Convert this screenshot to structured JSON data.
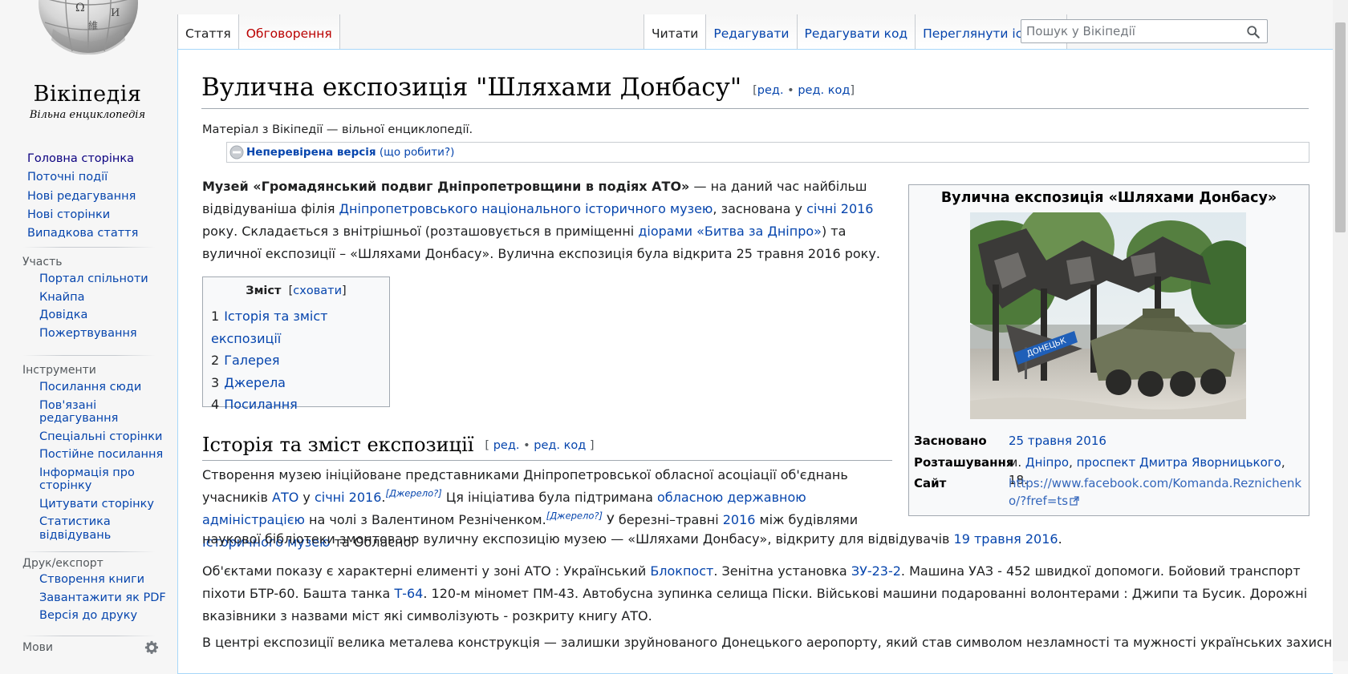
{
  "logo": {
    "wordmark": "Вікіпедія",
    "tagline": "Вільна енциклопедія"
  },
  "sidebar": {
    "main": [
      "Головна сторінка",
      "Поточні події",
      "Нові редагування",
      "Нові сторінки",
      "Випадкова стаття"
    ],
    "participation": {
      "heading": "Участь",
      "items": [
        "Портал спільноти",
        "Кнайпа",
        "Довідка",
        "Пожертвування"
      ]
    },
    "tools": {
      "heading": "Інструменти",
      "items": [
        "Посилання сюди",
        "Пов'язані редагування",
        "Спеціальні сторінки",
        "Постійне посилання",
        "Інформація про сторінку",
        "Цитувати сторінку",
        "Статистика відвідувань"
      ]
    },
    "print": {
      "heading": "Друк/експорт",
      "items": [
        "Створення книги",
        "Завантажити як PDF",
        "Версія до друку"
      ]
    },
    "languages": {
      "heading": "Мови",
      "icon": "gear-icon"
    }
  },
  "tabs": {
    "namespaces": [
      "Стаття",
      "Обговорення"
    ],
    "views": [
      "Читати",
      "Редагувати",
      "Редагувати код",
      "Переглянути історію"
    ]
  },
  "search": {
    "placeholder": "Пошук у Вікіпедії",
    "icon": "search-icon"
  },
  "article": {
    "title": "Вулична експозиція \"Шляхами Донбасу\"",
    "edit_links": {
      "open": "[",
      "edit": "ред.",
      "sep": " • ",
      "edit_source": "ред. код",
      "close": "]"
    },
    "site_sub": "Матеріал з Вікіпедії — вільної енциклопедії.",
    "flagged": {
      "status": "Неперевірена версія",
      "help": "(що робити?)"
    },
    "intro": {
      "bold": "Музей «Громадянський подвиг Дніпропетровщини в подіях АТО»",
      "t1": " — на даний час найбільш відвідуваніша філія ",
      "l1": "Дніпропетровського національного історичного музею",
      "t2": ", заснована у ",
      "l2": "січні 2016",
      "t3": " року. Складається з внітрішньої (розташовується в приміщенні ",
      "l3": "діорами «Битва за Дніпро»",
      "t4": ") та вуличної експозиції – «Шляхами Донбасу». Вулична експозиція була відкрита 25 травня 2016 року."
    },
    "toc": {
      "title": "Зміст",
      "toggle": "сховати",
      "items": [
        {
          "num": "1",
          "label": "Історія та зміст експозиції"
        },
        {
          "num": "2",
          "label": "Галерея"
        },
        {
          "num": "3",
          "label": "Джерела"
        },
        {
          "num": "4",
          "label": "Посилання"
        }
      ]
    },
    "section1": {
      "heading": "Історія та зміст експозиції",
      "p1": {
        "t1": "Створення музею ініційоване представниками Дніпропетровської обласної асоціації об'єднань учасників ",
        "l1": "АТО",
        "t2": " у ",
        "l2": "січні 2016",
        "t3": ".",
        "ref": "[Джерело?]",
        "t4": " Ця ініціатива була підтримана ",
        "l3": "обласною державною адміністрацією",
        "t5": " на чолі з Валентином Резніченком.",
        "ref2": "[Джерело?]",
        "t6": " У березні–травні ",
        "l4": "2016",
        "t7": " між будівлями ",
        "l5": "Історичного музею",
        "t8": " та Обласної"
      },
      "p1b": {
        "t1": "наукової бібліотеки змонтовано вуличну експозицію музею — «Шляхами Донбасу», відкриту для відвідувачів ",
        "l1": "19 травня 2016",
        "t2": "."
      },
      "p2": {
        "t1": "Об'єктами показу є характерні елименті у зоні АТО : Український ",
        "l1": "Блокпост",
        "t2": ". Зенітна установка ",
        "l2": "ЗУ-23-2",
        "t3": ".  Машина УАЗ - 452 швидкої допомоги. Бойовий транспорт піхоти БТР-60. Башта танка ",
        "l3": "Т-64",
        "t4": ". 120-м міномет ПМ-43.  Автобусна зупинка селища Піски. Військові машини подарованні волонтерами : Джипи та Бусик. Дорожні вказівники з назвами міст які символізують - розкриту книгу АТО."
      },
      "p3": "В центрі експозиції  велика металева конструкція — залишки зруйнованого Донецького аеропорту, який став символом незламності та мужності українських захисників,"
    },
    "infobox": {
      "title": "Вулична експозиція «Шляхами Донбасу»",
      "sign_text": "ДОНЕЦЬК",
      "rows": [
        {
          "label": "Засновано",
          "value_link": "25 травня 2016"
        },
        {
          "label": "Розташування",
          "prefix": "м. ",
          "l1": "Дніпро",
          "mid": ", ",
          "l2": "проспект Дмитра Яворницького",
          "suffix": ", 18."
        },
        {
          "label": "Сайт",
          "value_link": "https://www.facebook.com/Komanda.Reznichenko/?fref=ts"
        }
      ]
    }
  },
  "colors": {
    "link": "#0645ad",
    "new_link": "#ba0000",
    "sidebar_bg": "#f6f6f6",
    "content_border": "#a7d7f9"
  }
}
